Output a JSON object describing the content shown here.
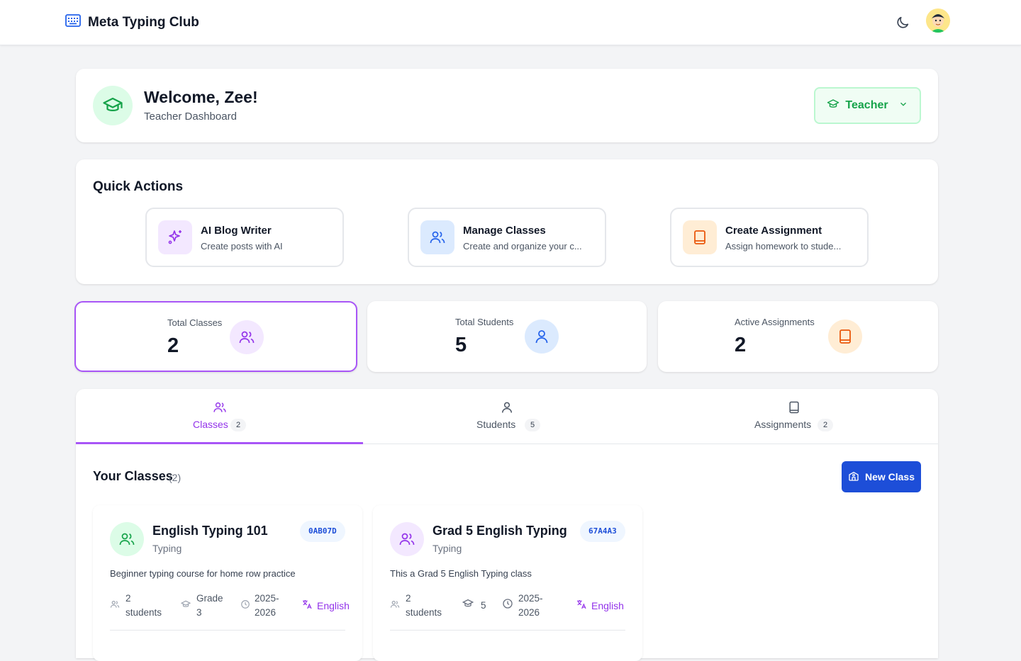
{
  "app": {
    "brand": "Meta Typing Club"
  },
  "welcome": {
    "title": "Welcome, Zee!",
    "subtitle": "Teacher Dashboard",
    "role": "Teacher"
  },
  "quick_actions": {
    "title": "Quick Actions",
    "items": [
      {
        "label": "AI Blog Writer",
        "desc": "Create posts with AI",
        "icon": "sparkles-icon",
        "color": "#9333ea"
      },
      {
        "label": "Manage Classes",
        "desc": "Create and organize your c...",
        "icon": "users-icon",
        "color": "#2563eb"
      },
      {
        "label": "Create Assignment",
        "desc": "Assign homework to stude...",
        "icon": "book-icon",
        "color": "#ea580c"
      }
    ]
  },
  "stats": [
    {
      "label": "Total Classes",
      "value": "2"
    },
    {
      "label": "Total Students",
      "value": "5"
    },
    {
      "label": "Active Assignments",
      "value": "2"
    }
  ],
  "tabs": [
    {
      "label": "Classes",
      "count": "2"
    },
    {
      "label": "Students",
      "count": "5"
    },
    {
      "label": "Assignments",
      "count": "2"
    }
  ],
  "classes_section": {
    "title": "Your Classes",
    "count": "(2)",
    "new_button": "New Class"
  },
  "classes": [
    {
      "name": "English Typing 101",
      "category": "Typing",
      "code": "0AB07D",
      "desc": "Beginner typing course for home row practice",
      "students_1": "2",
      "students_2": "students",
      "grade_1": "Grade",
      "grade_2": "3",
      "year_1": "2025-",
      "year_2": "2026",
      "language": "English"
    },
    {
      "name": "Grad 5 English Typing",
      "category": "Typing",
      "code": "67A4A3",
      "desc": "This a Grad 5 English Typing class",
      "students_1": "2",
      "students_2": "students",
      "grade_1": "5",
      "grade_2": "",
      "year_1": "2025-",
      "year_2": "2026",
      "language": "English"
    }
  ]
}
